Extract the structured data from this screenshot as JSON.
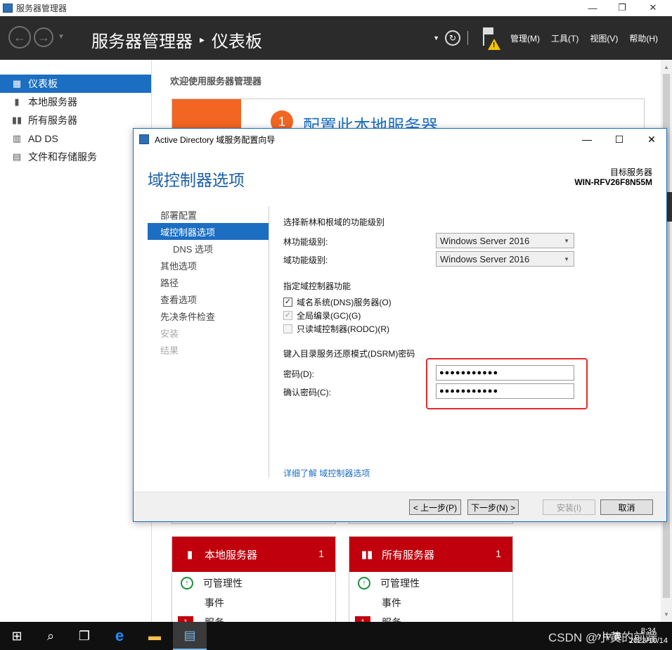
{
  "window": {
    "title": "服务器管理器",
    "controls": {
      "minimize": "—",
      "maximize": "❐",
      "close": "✕"
    }
  },
  "header": {
    "breadcrumb_root": "服务器管理器",
    "breadcrumb_sep": "▸",
    "breadcrumb_current": "仪表板",
    "menus": [
      "管理(M)",
      "工具(T)",
      "视图(V)",
      "帮助(H)"
    ]
  },
  "sidebar": {
    "items": [
      {
        "label": "仪表板",
        "icon": "dashboard-icon",
        "active": true
      },
      {
        "label": "本地服务器",
        "icon": "server-icon"
      },
      {
        "label": "所有服务器",
        "icon": "servers-icon"
      },
      {
        "label": "AD DS",
        "icon": "adds-icon"
      },
      {
        "label": "文件和存储服务",
        "icon": "storage-icon"
      }
    ]
  },
  "main": {
    "welcome": "欢迎使用服务器管理器",
    "quickstart_num": "1",
    "quickstart_text": "配置此本地服务器",
    "tiles": [
      {
        "title": "本地服务器",
        "count": "1",
        "rows": [
          "可管理性",
          "事件",
          "服务"
        ],
        "badge": "1"
      },
      {
        "title": "所有服务器",
        "count": "1",
        "rows": [
          "可管理性",
          "事件",
          "服务"
        ],
        "badge": "1"
      }
    ]
  },
  "dialog": {
    "title": "Active Directory 域服务配置向导",
    "heading": "域控制器选项",
    "target_label": "目标服务器",
    "target_name": "WIN-RFV26F8N55M",
    "steps": [
      {
        "label": "部署配置",
        "state": "normal"
      },
      {
        "label": "域控制器选项",
        "state": "active"
      },
      {
        "label": "DNS 选项",
        "state": "sub"
      },
      {
        "label": "其他选项",
        "state": "normal"
      },
      {
        "label": "路径",
        "state": "normal"
      },
      {
        "label": "查看选项",
        "state": "normal"
      },
      {
        "label": "先决条件检查",
        "state": "normal"
      },
      {
        "label": "安装",
        "state": "disabled"
      },
      {
        "label": "结果",
        "state": "disabled"
      }
    ],
    "form": {
      "level_heading": "选择新林和根域的功能级别",
      "forest_label": "林功能级别:",
      "forest_value": "Windows Server 2016",
      "domain_label": "域功能级别:",
      "domain_value": "Windows Server 2016",
      "dc_heading": "指定域控制器功能",
      "dns_cb": "域名系统(DNS)服务器(O)",
      "gc_cb": "全局编录(GC)(G)",
      "rodc_cb": "只读域控制器(RODC)(R)",
      "dsrm_heading": "键入目录服务还原模式(DSRM)密码",
      "password_label": "密码(D):",
      "password_value": "●●●●●●●●●●●",
      "confirm_label": "确认密码(C):",
      "confirm_value": "●●●●●●●●●●●",
      "learn_more": "详细了解 域控制器选项"
    },
    "buttons": {
      "prev": "< 上一步(P)",
      "next": "下一步(N) >",
      "install": "安装(I)",
      "cancel": "取消"
    }
  },
  "taskbar": {
    "tray_text": "^ 中 英",
    "time": "8:34",
    "date": "2023/10/14",
    "watermark": "CSDN @小黄的前端"
  }
}
